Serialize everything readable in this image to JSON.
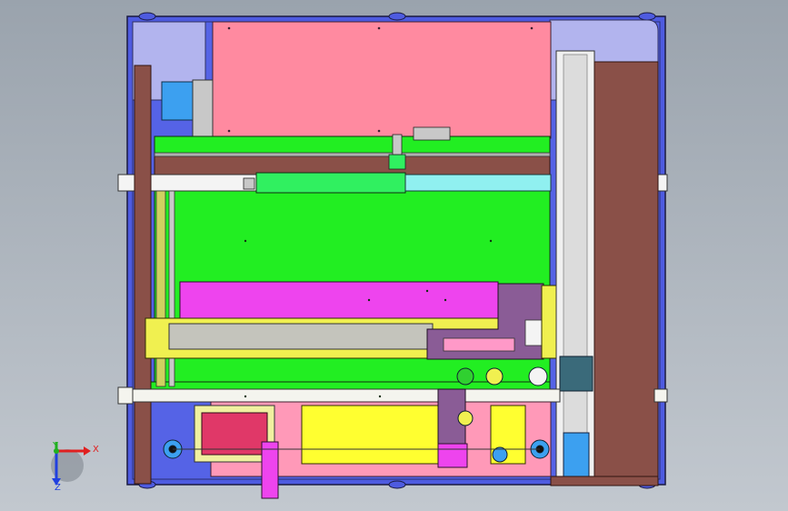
{
  "viewport": {
    "background_top": "#9aa3ad",
    "background_bottom": "#c2c8cf"
  },
  "triad": {
    "x_label": "X",
    "y_label": "Y",
    "z_label": "Z",
    "x_color": "#e02020",
    "y_color": "#20b020",
    "z_color": "#2040e0"
  },
  "model_colors": {
    "frame_blue": "#4e5be0",
    "corner_lavender": "#b2b4ee",
    "plate_pink": "#ff8aa0",
    "bed_green": "#22ee22",
    "rail_brown": "#8a5048",
    "beam_yellow": "#f0f050",
    "beam_grey": "#c4c4bc",
    "slide_magenta": "#ee44ee",
    "carriage_purple": "#8a5c96",
    "rail_cyan": "#90f0f0",
    "tray_yellow": "#ffff30",
    "tray_pink": "#ff99b8",
    "box_crimson": "#e03868"
  }
}
